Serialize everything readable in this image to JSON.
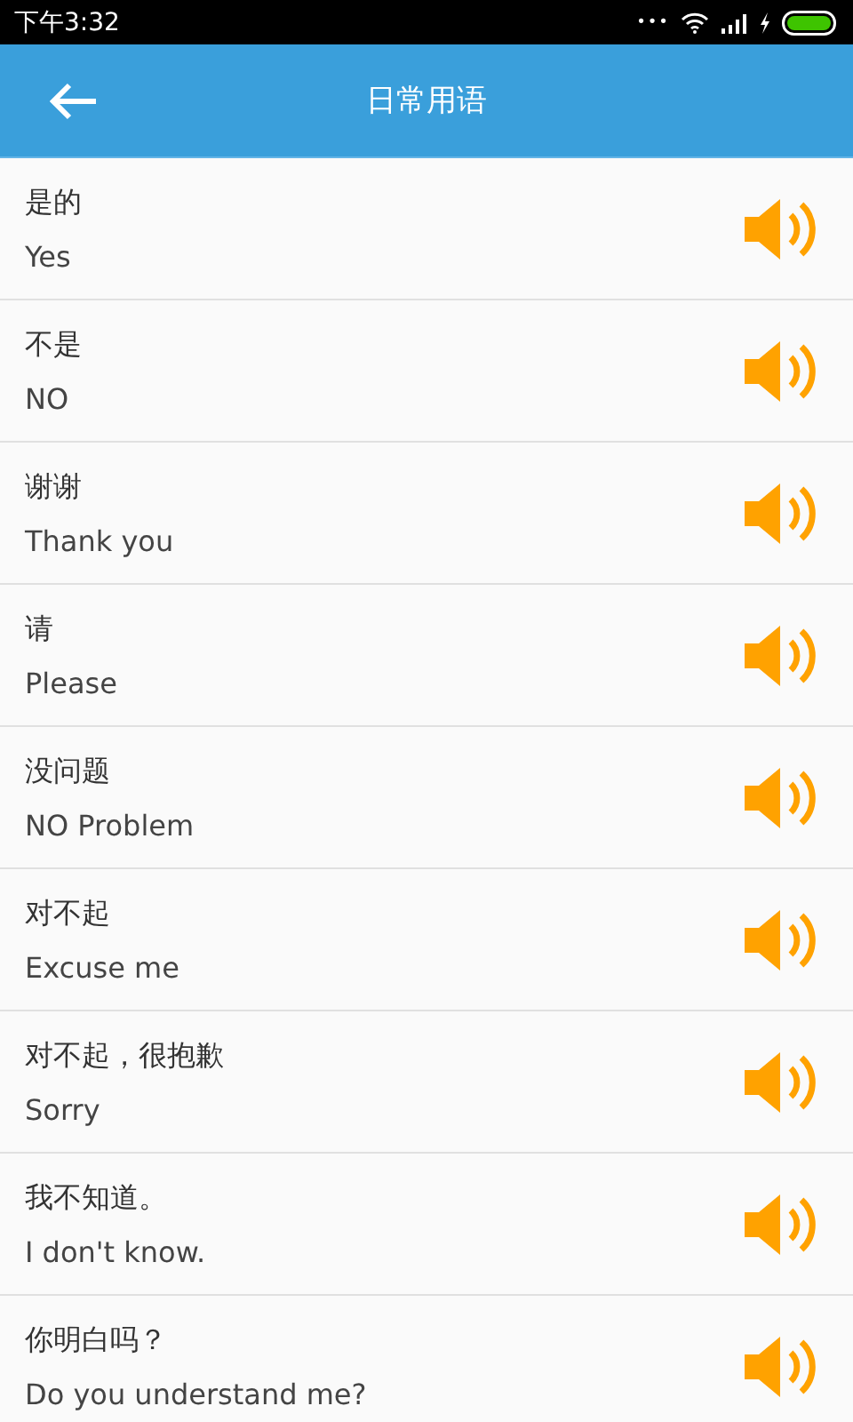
{
  "status_bar": {
    "time": "下午3:32",
    "dots": "•••"
  },
  "header": {
    "title": "日常用语"
  },
  "phrases": [
    {
      "chinese": "是的",
      "english": "Yes"
    },
    {
      "chinese": "不是",
      "english": "NO"
    },
    {
      "chinese": "谢谢",
      "english": "Thank you"
    },
    {
      "chinese": "请",
      "english": "Please"
    },
    {
      "chinese": "没问题",
      "english": "NO Problem"
    },
    {
      "chinese": "对不起",
      "english": "Excuse me"
    },
    {
      "chinese": "对不起，很抱歉",
      "english": "Sorry"
    },
    {
      "chinese": "我不知道。",
      "english": "I don't know."
    },
    {
      "chinese": "你明白吗？",
      "english": "Do you understand me?"
    }
  ]
}
